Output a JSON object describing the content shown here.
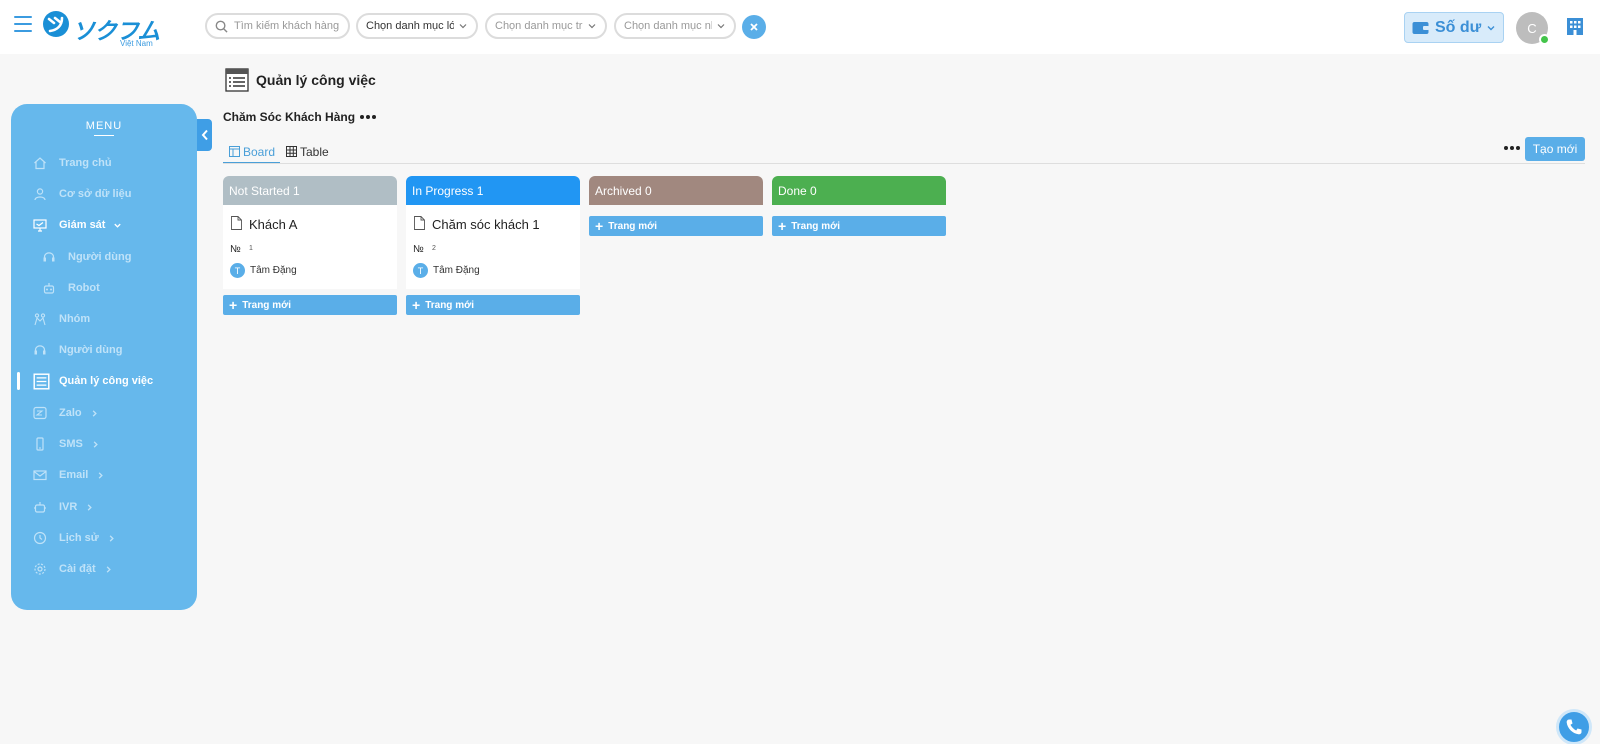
{
  "header": {
    "logo_text": "ソクフム",
    "logo_sub": "Việt Nam",
    "search_placeholder": "Tìm kiếm khách hàng",
    "filter_large": "Chọn danh mục lớn",
    "filter_medium": "Chọn danh mục trung",
    "filter_small": "Chọn danh mục nhỏ",
    "balance_label": "Số dư",
    "avatar_initial": "C"
  },
  "sidebar": {
    "title": "MENU",
    "items": [
      {
        "label": "Trang chủ",
        "icon": "home-icon"
      },
      {
        "label": "Cơ sở dữ liệu",
        "icon": "user-icon"
      },
      {
        "label": "Giám sát",
        "icon": "monitor-icon"
      },
      {
        "label": "Người dùng",
        "icon": "headset-icon"
      },
      {
        "label": "Robot",
        "icon": "robot-icon"
      },
      {
        "label": "Nhóm",
        "icon": "group-icon"
      },
      {
        "label": "Người dùng",
        "icon": "headset-icon"
      },
      {
        "label": "Quản lý công việc",
        "icon": "task-icon"
      },
      {
        "label": "Zalo",
        "icon": "zalo-icon"
      },
      {
        "label": "SMS",
        "icon": "phone-icon"
      },
      {
        "label": "Email",
        "icon": "mail-icon"
      },
      {
        "label": "IVR",
        "icon": "ivr-icon"
      },
      {
        "label": "Lịch sử",
        "icon": "clock-icon"
      },
      {
        "label": "Cài đặt",
        "icon": "gear-icon"
      }
    ]
  },
  "main": {
    "page_title": "Quản lý công việc",
    "section_title": "Chăm Sóc Khách Hàng",
    "tabs": {
      "board": "Board",
      "table": "Table"
    },
    "create_label": "Tạo mới",
    "columns": [
      {
        "title": "Not Started 1",
        "color": "#b0bec5",
        "new_label": "Trang mới",
        "cards": [
          {
            "title": "Khách A",
            "no_label": "№",
            "number": "1",
            "user_initial": "T",
            "user": "Tâm Đặng"
          }
        ]
      },
      {
        "title": "In Progress 1",
        "color": "#2196f3",
        "new_label": "Trang mới",
        "cards": [
          {
            "title": "Chăm sóc khách 1",
            "no_label": "№",
            "number": "2",
            "user_initial": "T",
            "user": "Tâm Đặng"
          }
        ]
      },
      {
        "title": "Archived 0",
        "color": "#a1887f",
        "new_label": "Trang mới",
        "cards": []
      },
      {
        "title": "Done 0",
        "color": "#4caf50",
        "new_label": "Trang mới",
        "cards": []
      }
    ]
  }
}
